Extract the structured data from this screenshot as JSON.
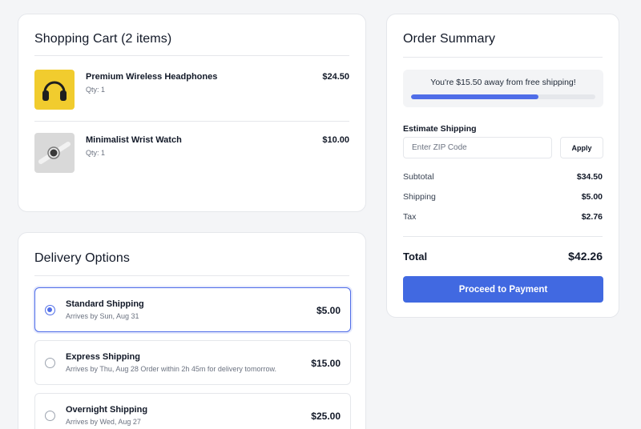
{
  "cart": {
    "title": "Shopping Cart (2 items)",
    "items": [
      {
        "name": "Premium Wireless Headphones",
        "qty": "Qty: 1",
        "price": "$24.50",
        "image": "headphones-image"
      },
      {
        "name": "Minimalist Wrist Watch",
        "qty": "Qty: 1",
        "price": "$10.00",
        "image": "wrist-watch-image"
      }
    ]
  },
  "delivery": {
    "title": "Delivery Options",
    "options": [
      {
        "name": "Standard Shipping",
        "sub": "Arrives by Sun, Aug 31",
        "price": "$5.00",
        "selected": true
      },
      {
        "name": "Express Shipping",
        "sub": "Arrives by Thu, Aug 28 Order within 2h 45m for delivery tomorrow.",
        "price": "$15.00",
        "selected": false
      },
      {
        "name": "Overnight Shipping",
        "sub": "Arrives by Wed, Aug 27",
        "price": "$25.00",
        "selected": false
      }
    ]
  },
  "summary": {
    "title": "Order Summary",
    "free_shipping_text": "You're $15.50 away from free shipping!",
    "free_shipping_progress": 0.69,
    "estimate_label": "Estimate Shipping",
    "zip_placeholder": "Enter ZIP Code",
    "apply_label": "Apply",
    "subtotal_label": "Subtotal",
    "subtotal_value": "$34.50",
    "shipping_label": "Shipping",
    "shipping_value": "$5.00",
    "tax_label": "Tax",
    "tax_value": "$2.76",
    "total_label": "Total",
    "total_value": "$42.26",
    "pay_label": "Proceed to Payment"
  },
  "colors": {
    "accent": "#4169e1",
    "selected_border": "#4f6de8",
    "page_bg": "#f4f5f7"
  }
}
